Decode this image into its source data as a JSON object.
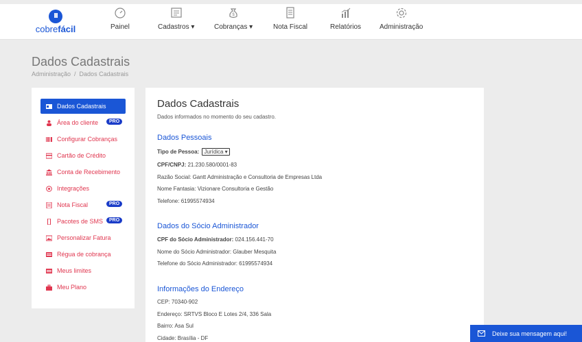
{
  "brand": {
    "badge": "III",
    "name_part1": "cobre",
    "name_part2": "fácil"
  },
  "nav": [
    {
      "label": "Painel",
      "icon": "gauge-icon"
    },
    {
      "label": "Cadastros",
      "icon": "form-icon"
    },
    {
      "label": "Cobranças",
      "icon": "money-bag-icon"
    },
    {
      "label": "Nota Fiscal",
      "icon": "document-icon"
    },
    {
      "label": "Relatórios",
      "icon": "bar-chart-icon"
    },
    {
      "label": "Administração",
      "icon": "gear-icon"
    }
  ],
  "nav_caret": " ▾",
  "page": {
    "title": "Dados Cadastrais"
  },
  "breadcrumb": {
    "root": "Administração",
    "separator": "/",
    "current": "Dados Cadastrais"
  },
  "sidebar": {
    "items": [
      {
        "label": "Dados Cadastrais",
        "icon": "id-card-icon",
        "active": true
      },
      {
        "label": "Área do cliente",
        "icon": "user-icon",
        "badge": "PRO"
      },
      {
        "label": "Configurar Cobranças",
        "icon": "barcode-icon"
      },
      {
        "label": "Cartão de Crédito",
        "icon": "credit-card-icon"
      },
      {
        "label": "Conta de Recebimento",
        "icon": "bank-icon"
      },
      {
        "label": "Integrações",
        "icon": "plug-icon"
      },
      {
        "label": "Nota Fiscal",
        "icon": "invoice-icon",
        "badge": "PRO"
      },
      {
        "label": "Pacotes de SMS",
        "icon": "phone-icon",
        "badge": "PRO"
      },
      {
        "label": "Personalizar Fatura",
        "icon": "image-icon"
      },
      {
        "label": "Régua de cobrança",
        "icon": "ruler-icon"
      },
      {
        "label": "Meus limites",
        "icon": "list-icon"
      },
      {
        "label": "Meu Plano",
        "icon": "briefcase-icon"
      }
    ],
    "active_color": "#1a56d6",
    "item_color": "#e0364f"
  },
  "main": {
    "title": "Dados Cadastrais",
    "lead": "Dados informados no momento do seu cadastro.",
    "pessoais": {
      "heading": "Dados Pessoais",
      "tipo_label": "Tipo de Pessoa:",
      "tipo_value": "Jurídica",
      "cnpj_label": "CPF/CNPJ:",
      "cnpj_value": "21.230.580/0001-83",
      "razao": "Razão Social: Gantt Administração e Consultoria de Empresas Ltda",
      "fantasia": "Nome Fantasia: Vizionare Consultoria e Gestão",
      "telefone": "Telefone: 61995574934"
    },
    "socio": {
      "heading": "Dados do Sócio Administrador",
      "cpf_label": "CPF do Sócio Administrador:",
      "cpf_value": "024.156.441-70",
      "nome": "Nome do Sócio Administrador: Glauber Mesquita",
      "telefone": "Telefone do Sócio Administrador: 61995574934"
    },
    "endereco": {
      "heading": "Informações do Endereço",
      "cep": "CEP: 70340-902",
      "endereco": "Endereço: SRTVS Bloco E Lotes 2/4, 336 Sala",
      "bairro": "Bairro: Asa Sul",
      "cidade": "Cidade: Brasília - DF"
    }
  },
  "chat": {
    "label": "Deixe sua mensagem aqui!",
    "icon": "message-icon"
  },
  "colors": {
    "accent": "#1a56d6",
    "danger": "#e0364f",
    "background": "#ececec"
  }
}
